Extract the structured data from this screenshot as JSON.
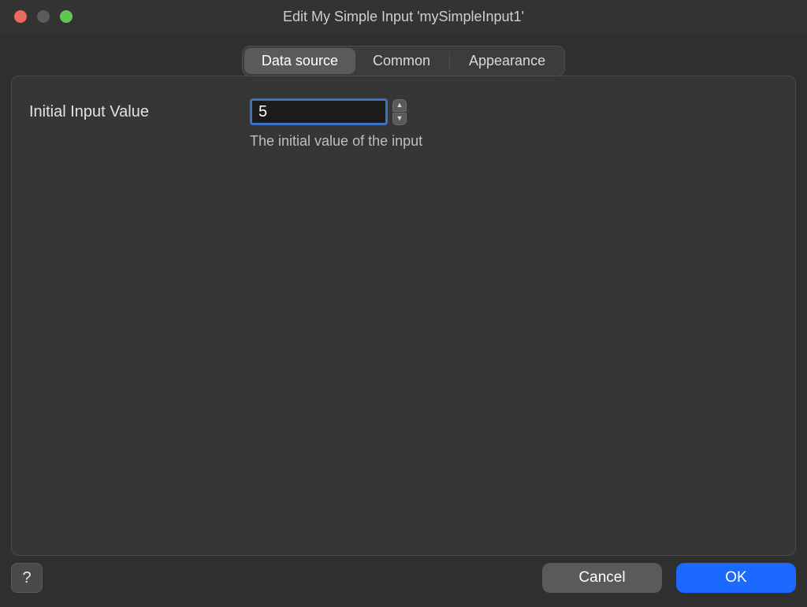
{
  "window": {
    "title": "Edit My Simple Input 'mySimpleInput1'"
  },
  "tabs": {
    "data_source": "Data source",
    "common": "Common",
    "appearance": "Appearance",
    "active": "data_source"
  },
  "form": {
    "initial_input_value": {
      "label": "Initial Input Value",
      "value": "5",
      "hint": "The initial value of the input"
    }
  },
  "footer": {
    "help": "?",
    "cancel": "Cancel",
    "ok": "OK"
  }
}
